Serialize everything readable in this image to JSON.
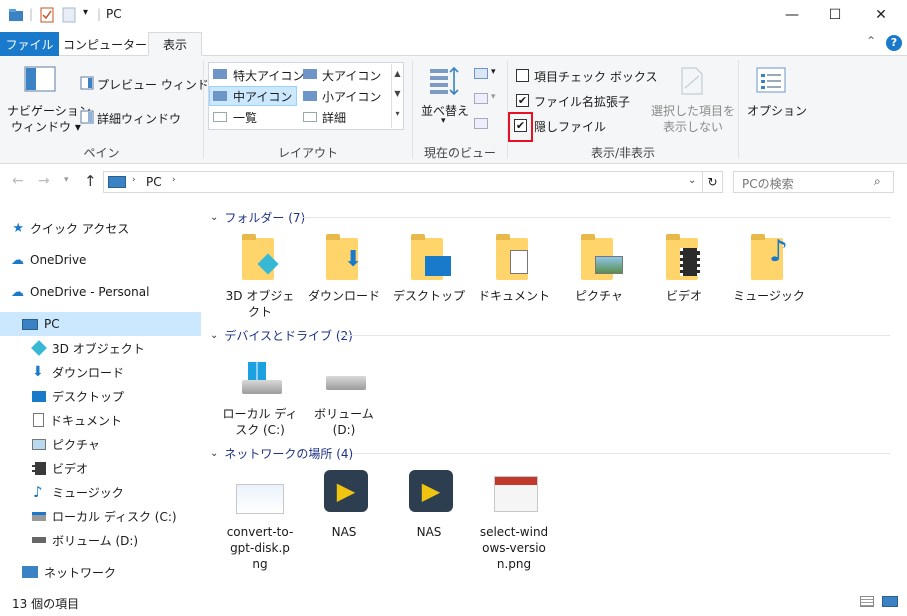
{
  "window": {
    "title": "PC"
  },
  "tabs": {
    "file": "ファイル",
    "computer": "コンピューター",
    "view": "表示"
  },
  "ribbon": {
    "pane": {
      "nav_pane_line1": "ナビゲーション",
      "nav_pane_line2": "ウィンドウ",
      "preview": "プレビュー ウィンドウ",
      "details": "詳細ウィンドウ",
      "group_label": "ペイン"
    },
    "layout": {
      "xl_icons": "特大アイコン",
      "l_icons": "大アイコン",
      "m_icons": "中アイコン",
      "s_icons": "小アイコン",
      "list": "一覧",
      "details": "詳細",
      "group_label": "レイアウト"
    },
    "current_view": {
      "sort": "並べ替え",
      "group_label": "現在のビュー"
    },
    "show_hide": {
      "item_checkboxes": "項目チェック ボックス",
      "file_ext": "ファイル名拡張子",
      "hidden_files": "隠しファイル",
      "hide_selected_line1": "選択した項目を",
      "hide_selected_line2": "表示しない",
      "group_label": "表示/非表示",
      "item_checkboxes_checked": false,
      "file_ext_checked": true,
      "hidden_files_checked": true
    },
    "options": "オプション"
  },
  "address": {
    "path": "PC",
    "search_placeholder": "PCの検索"
  },
  "nav": {
    "quick_access": "クイック アクセス",
    "onedrive": "OneDrive",
    "onedrive_personal": "OneDrive - Personal",
    "pc": "PC",
    "obj3d": "3D オブジェクト",
    "downloads": "ダウンロード",
    "desktop": "デスクトップ",
    "documents": "ドキュメント",
    "pictures": "ピクチャ",
    "videos": "ビデオ",
    "music": "ミュージック",
    "local_disk": "ローカル ディスク (C:)",
    "volume": "ボリューム (D:)",
    "network": "ネットワーク"
  },
  "content": {
    "folders_header": "フォルダー (7)",
    "folders": {
      "obj3d_l1": "3D オブジェ",
      "obj3d_l2": "クト",
      "downloads": "ダウンロード",
      "desktop": "デスクトップ",
      "documents": "ドキュメント",
      "pictures": "ピクチャ",
      "videos": "ビデオ",
      "music": "ミュージック"
    },
    "drives_header": "デバイスとドライブ (2)",
    "drives": {
      "c_l1": "ローカル ディ",
      "c_l2": "スク (C:)",
      "d_l1": "ボリューム",
      "d_l2": "(D:)"
    },
    "network_header": "ネットワークの場所 (4)",
    "network": {
      "n1_l1": "convert-to-",
      "n1_l2": "gpt-disk.p",
      "n1_l3": "ng",
      "n2": "NAS",
      "n3": "NAS",
      "n4_l1": "select-wind",
      "n4_l2": "ows-versio",
      "n4_l3": "n.png"
    }
  },
  "status": {
    "count": "13 個の項目"
  },
  "colors": {
    "file_tab": "#1979ca",
    "selection": "#cce8ff",
    "highlight_box": "#e81123",
    "section_text": "#1e3287"
  }
}
